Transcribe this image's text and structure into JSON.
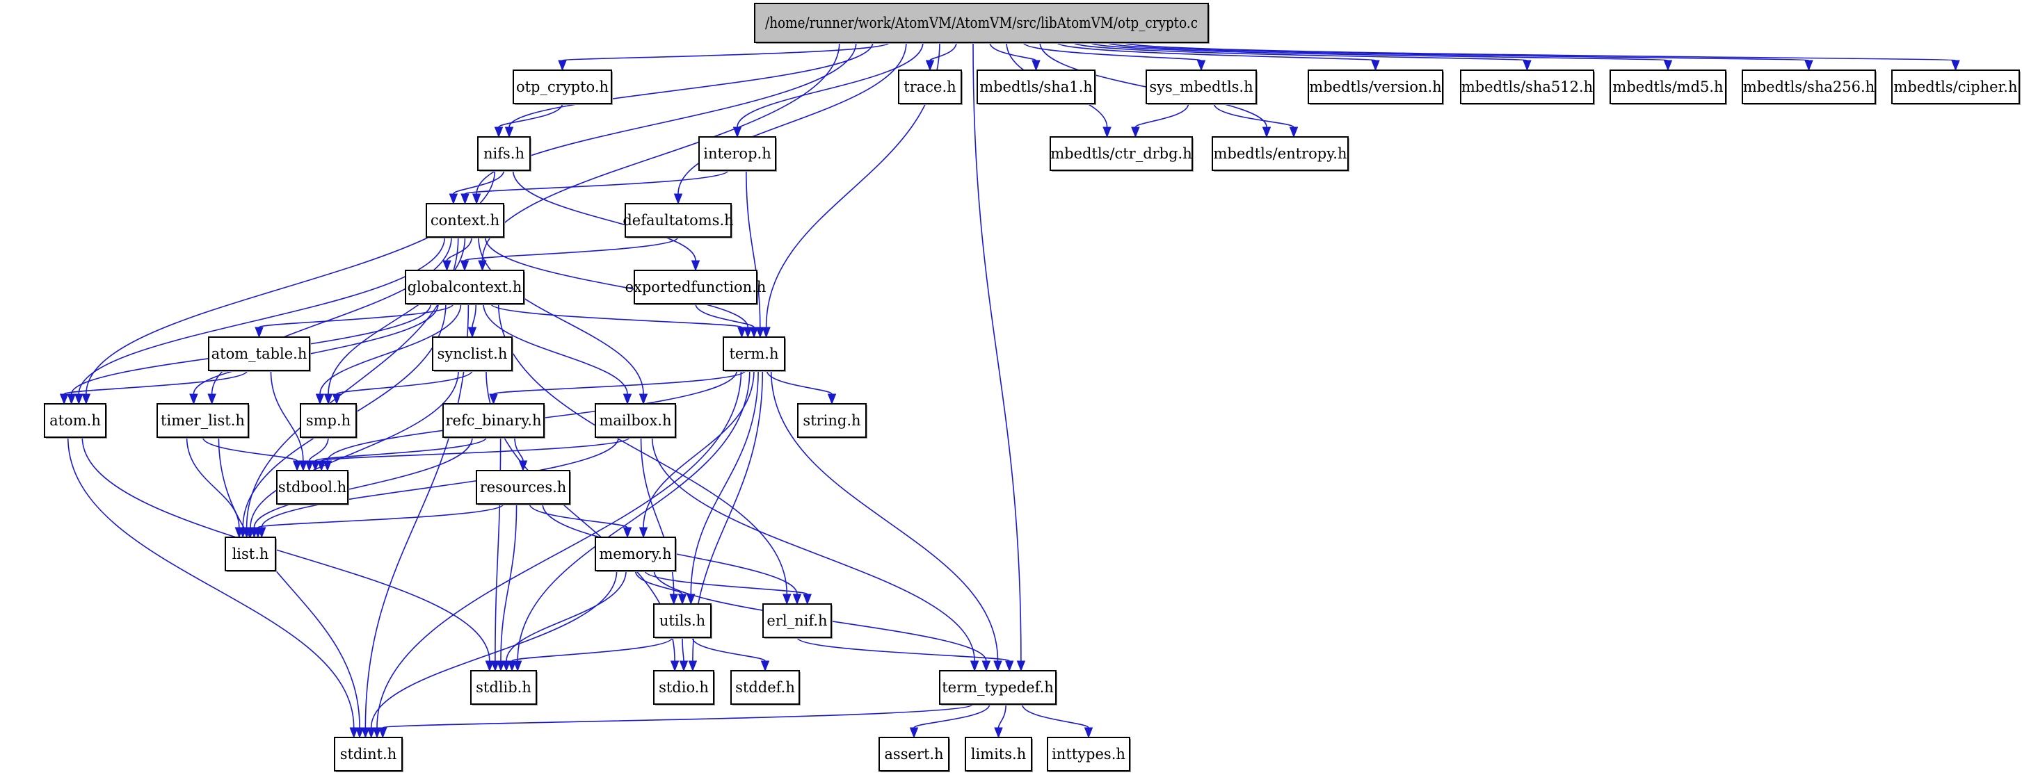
{
  "title": "/home/runner/work/AtomVM/AtomVM/src/libAtomVM/otp_crypto.c",
  "colors": {
    "edge": "#1a1acd",
    "root_fill": "#bfbfbf",
    "node_fill": "#ffffff",
    "node_border": "#000000"
  },
  "graph": {
    "root": "otp_crypto.c",
    "nodes": [
      {
        "id": "otp_crypto.c",
        "label": "/home/runner/work/AtomVM/AtomVM/src/libAtomVM/otp_crypto.c",
        "root": true
      },
      {
        "id": "otp_crypto.h",
        "label": "otp_crypto.h"
      },
      {
        "id": "trace.h",
        "label": "trace.h"
      },
      {
        "id": "mbedtls/sha1.h",
        "label": "mbedtls/sha1.h"
      },
      {
        "id": "sys_mbedtls.h",
        "label": "sys_mbedtls.h"
      },
      {
        "id": "mbedtls/version.h",
        "label": "mbedtls/version.h"
      },
      {
        "id": "mbedtls/sha512.h",
        "label": "mbedtls/sha512.h"
      },
      {
        "id": "mbedtls/md5.h",
        "label": "mbedtls/md5.h"
      },
      {
        "id": "mbedtls/sha256.h",
        "label": "mbedtls/sha256.h"
      },
      {
        "id": "mbedtls/cipher.h",
        "label": "mbedtls/cipher.h"
      },
      {
        "id": "nifs.h",
        "label": "nifs.h"
      },
      {
        "id": "interop.h",
        "label": "interop.h"
      },
      {
        "id": "mbedtls/ctr_drbg.h",
        "label": "mbedtls/ctr_drbg.h"
      },
      {
        "id": "mbedtls/entropy.h",
        "label": "mbedtls/entropy.h"
      },
      {
        "id": "context.h",
        "label": "context.h"
      },
      {
        "id": "defaultatoms.h",
        "label": "defaultatoms.h"
      },
      {
        "id": "globalcontext.h",
        "label": "globalcontext.h"
      },
      {
        "id": "exportedfunction.h",
        "label": "exportedfunction.h"
      },
      {
        "id": "atom_table.h",
        "label": "atom_table.h"
      },
      {
        "id": "synclist.h",
        "label": "synclist.h"
      },
      {
        "id": "term.h",
        "label": "term.h"
      },
      {
        "id": "atom.h",
        "label": "atom.h"
      },
      {
        "id": "timer_list.h",
        "label": "timer_list.h"
      },
      {
        "id": "smp.h",
        "label": "smp.h"
      },
      {
        "id": "refc_binary.h",
        "label": "refc_binary.h"
      },
      {
        "id": "mailbox.h",
        "label": "mailbox.h"
      },
      {
        "id": "string.h",
        "label": "string.h"
      },
      {
        "id": "stdbool.h",
        "label": "stdbool.h"
      },
      {
        "id": "resources.h",
        "label": "resources.h"
      },
      {
        "id": "list.h",
        "label": "list.h"
      },
      {
        "id": "memory.h",
        "label": "memory.h"
      },
      {
        "id": "utils.h",
        "label": "utils.h"
      },
      {
        "id": "erl_nif.h",
        "label": "erl_nif.h"
      },
      {
        "id": "stdlib.h",
        "label": "stdlib.h"
      },
      {
        "id": "stdio.h",
        "label": "stdio.h"
      },
      {
        "id": "stddef.h",
        "label": "stddef.h"
      },
      {
        "id": "term_typedef.h",
        "label": "term_typedef.h"
      },
      {
        "id": "stdint.h",
        "label": "stdint.h"
      },
      {
        "id": "assert.h",
        "label": "assert.h"
      },
      {
        "id": "limits.h",
        "label": "limits.h"
      },
      {
        "id": "inttypes.h",
        "label": "inttypes.h"
      }
    ],
    "edges": [
      [
        "otp_crypto.c",
        "nifs.h"
      ],
      [
        "otp_crypto.c",
        "context.h"
      ],
      [
        "otp_crypto.c",
        "otp_crypto.h"
      ],
      [
        "otp_crypto.c",
        "globalcontext.h"
      ],
      [
        "otp_crypto.c",
        "interop.h"
      ],
      [
        "otp_crypto.c",
        "defaultatoms.h"
      ],
      [
        "otp_crypto.c",
        "term.h"
      ],
      [
        "otp_crypto.c",
        "term_typedef.h"
      ],
      [
        "otp_crypto.c",
        "trace.h"
      ],
      [
        "otp_crypto.c",
        "mbedtls/sha1.h"
      ],
      [
        "otp_crypto.c",
        "sys_mbedtls.h"
      ],
      [
        "otp_crypto.c",
        "mbedtls/ctr_drbg.h"
      ],
      [
        "otp_crypto.c",
        "mbedtls/entropy.h"
      ],
      [
        "otp_crypto.c",
        "mbedtls/version.h"
      ],
      [
        "otp_crypto.c",
        "mbedtls/sha512.h"
      ],
      [
        "otp_crypto.c",
        "mbedtls/md5.h"
      ],
      [
        "otp_crypto.c",
        "mbedtls/sha256.h"
      ],
      [
        "otp_crypto.c",
        "mbedtls/cipher.h"
      ],
      [
        "otp_crypto.h",
        "nifs.h"
      ],
      [
        "sys_mbedtls.h",
        "mbedtls/ctr_drbg.h"
      ],
      [
        "sys_mbedtls.h",
        "mbedtls/entropy.h"
      ],
      [
        "nifs.h",
        "context.h"
      ],
      [
        "nifs.h",
        "atom.h"
      ],
      [
        "nifs.h",
        "exportedfunction.h"
      ],
      [
        "interop.h",
        "context.h"
      ],
      [
        "interop.h",
        "term.h"
      ],
      [
        "defaultatoms.h",
        "globalcontext.h"
      ],
      [
        "exportedfunction.h",
        "term.h"
      ],
      [
        "context.h",
        "globalcontext.h"
      ],
      [
        "context.h",
        "term.h"
      ],
      [
        "context.h",
        "mailbox.h"
      ],
      [
        "context.h",
        "smp.h"
      ],
      [
        "context.h",
        "timer_list.h"
      ],
      [
        "context.h",
        "list.h"
      ],
      [
        "context.h",
        "atom.h"
      ],
      [
        "globalcontext.h",
        "atom.h"
      ],
      [
        "globalcontext.h",
        "atom_table.h"
      ],
      [
        "globalcontext.h",
        "timer_list.h"
      ],
      [
        "globalcontext.h",
        "smp.h"
      ],
      [
        "globalcontext.h",
        "synclist.h"
      ],
      [
        "globalcontext.h",
        "mailbox.h"
      ],
      [
        "globalcontext.h",
        "term.h"
      ],
      [
        "globalcontext.h",
        "erl_nif.h"
      ],
      [
        "globalcontext.h",
        "list.h"
      ],
      [
        "globalcontext.h",
        "stdint.h"
      ],
      [
        "atom_table.h",
        "atom.h"
      ],
      [
        "atom_table.h",
        "stdbool.h"
      ],
      [
        "synclist.h",
        "smp.h"
      ],
      [
        "synclist.h",
        "list.h"
      ],
      [
        "synclist.h",
        "stdio.h"
      ],
      [
        "term.h",
        "refc_binary.h"
      ],
      [
        "term.h",
        "string.h"
      ],
      [
        "term.h",
        "memory.h"
      ],
      [
        "term.h",
        "utils.h"
      ],
      [
        "term.h",
        "stdbool.h"
      ],
      [
        "term.h",
        "stdlib.h"
      ],
      [
        "term.h",
        "stdio.h"
      ],
      [
        "term.h",
        "stdint.h"
      ],
      [
        "term.h",
        "term_typedef.h"
      ],
      [
        "atom.h",
        "stdint.h"
      ],
      [
        "atom.h",
        "stdlib.h"
      ],
      [
        "timer_list.h",
        "list.h"
      ],
      [
        "timer_list.h",
        "stdbool.h"
      ],
      [
        "timer_list.h",
        "stdint.h"
      ],
      [
        "smp.h",
        "stdbool.h"
      ],
      [
        "refc_binary.h",
        "resources.h"
      ],
      [
        "refc_binary.h",
        "stdbool.h"
      ],
      [
        "refc_binary.h",
        "list.h"
      ],
      [
        "refc_binary.h",
        "stdlib.h"
      ],
      [
        "mailbox.h",
        "stdbool.h"
      ],
      [
        "mailbox.h",
        "list.h"
      ],
      [
        "mailbox.h",
        "utils.h"
      ],
      [
        "mailbox.h",
        "term_typedef.h"
      ],
      [
        "resources.h",
        "memory.h"
      ],
      [
        "resources.h",
        "list.h"
      ],
      [
        "resources.h",
        "stdlib.h"
      ],
      [
        "resources.h",
        "erl_nif.h"
      ],
      [
        "memory.h",
        "utils.h"
      ],
      [
        "memory.h",
        "erl_nif.h"
      ],
      [
        "memory.h",
        "stdlib.h"
      ],
      [
        "memory.h",
        "stdint.h"
      ],
      [
        "memory.h",
        "term_typedef.h"
      ],
      [
        "utils.h",
        "stdlib.h"
      ],
      [
        "utils.h",
        "stdio.h"
      ],
      [
        "utils.h",
        "stddef.h"
      ],
      [
        "erl_nif.h",
        "term_typedef.h"
      ],
      [
        "term_typedef.h",
        "assert.h"
      ],
      [
        "term_typedef.h",
        "limits.h"
      ],
      [
        "term_typedef.h",
        "inttypes.h"
      ],
      [
        "term_typedef.h",
        "stdint.h"
      ]
    ]
  }
}
